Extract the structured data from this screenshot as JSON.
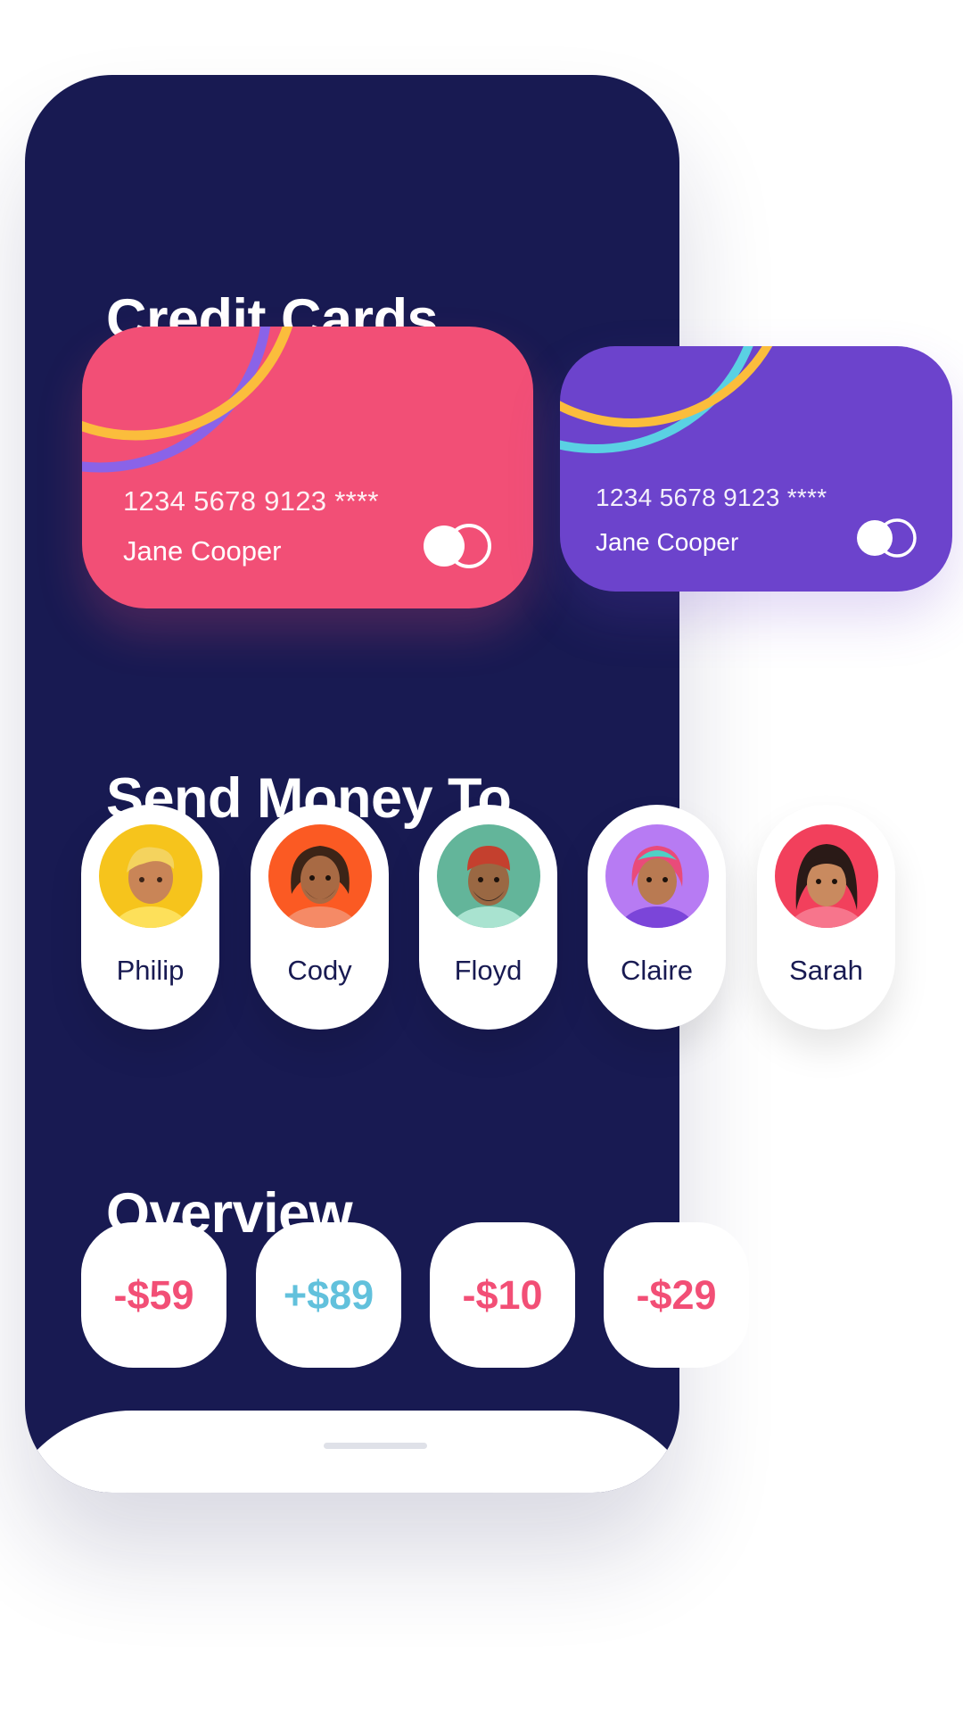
{
  "sections": {
    "credit_cards": "Credit Cards",
    "send_money": "Send Money To",
    "overview": "Overview"
  },
  "cards": [
    {
      "number": "1234 5678 9123 ****",
      "holder": "Jane Cooper",
      "color": "#f24f76"
    },
    {
      "number": "1234 5678 9123 ****",
      "holder": "Jane Cooper",
      "color": "#6c43cc"
    }
  ],
  "contacts": [
    {
      "name": "Philip",
      "avatar_bg": "#f6c41c",
      "icon": "avatar-icon"
    },
    {
      "name": "Cody",
      "avatar_bg": "#fb5a23",
      "icon": "avatar-icon"
    },
    {
      "name": "Floyd",
      "avatar_bg": "#63b59a",
      "icon": "avatar-icon"
    },
    {
      "name": "Claire",
      "avatar_bg": "#b77bf3",
      "icon": "avatar-icon"
    },
    {
      "name": "Sarah",
      "avatar_bg": "#f2405c",
      "icon": "avatar-icon"
    }
  ],
  "overview": [
    {
      "amount": "-$59",
      "kind": "negative"
    },
    {
      "amount": "+$89",
      "kind": "positive"
    },
    {
      "amount": "-$10",
      "kind": "negative"
    },
    {
      "amount": "-$29",
      "kind": "negative"
    }
  ],
  "colors": {
    "background": "#181a52",
    "accent_pink": "#f24f76",
    "accent_purple": "#6c43cc",
    "accent_yellow": "#fbbd3c",
    "positive": "#62c1dc"
  }
}
